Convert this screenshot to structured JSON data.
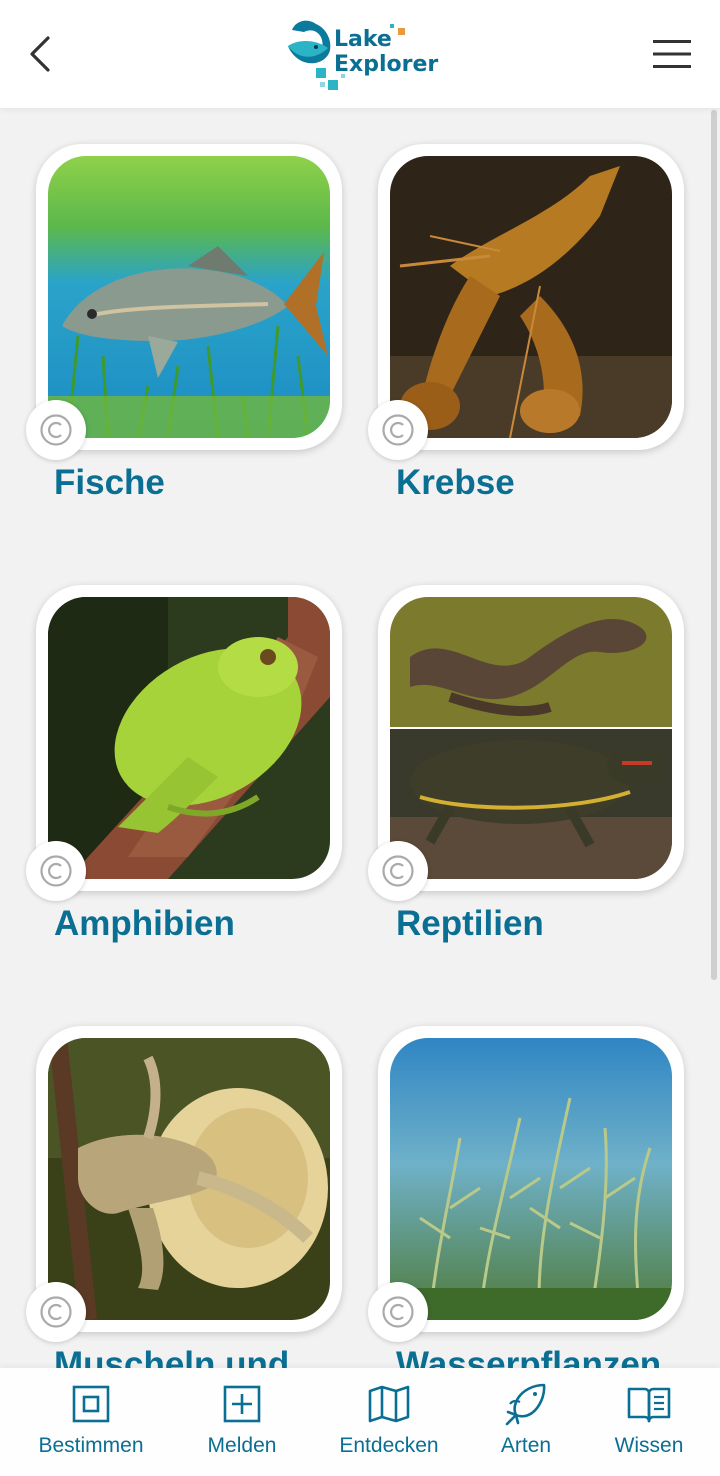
{
  "header": {
    "logo_line1": "Lake",
    "logo_line2": "Explorer",
    "back_icon": "chevron-left-icon",
    "menu_icon": "hamburger-menu-icon"
  },
  "categories": [
    {
      "label": "Fische",
      "image": "carp fish underwater"
    },
    {
      "label": "Krebse",
      "image": "crayfish"
    },
    {
      "label": "Amphibien",
      "image": "green tree frog on branch"
    },
    {
      "label": "Reptilien",
      "image": "grass snake and red-eared slider turtle"
    },
    {
      "label": "Muscheln und Schnecken",
      "image": "pond snail"
    },
    {
      "label": "Wasserpflanzen",
      "image": "underwater stonewort plants"
    }
  ],
  "copyright_icon": "copyright-icon",
  "bottom_nav": [
    {
      "label": "Bestimmen",
      "icon": "identify-square-icon"
    },
    {
      "label": "Melden",
      "icon": "report-plus-icon"
    },
    {
      "label": "Entdecken",
      "icon": "map-icon"
    },
    {
      "label": "Arten",
      "icon": "fish-species-icon"
    },
    {
      "label": "Wissen",
      "icon": "book-icon"
    }
  ],
  "colors": {
    "brand": "#0a6f93",
    "accent_orange": "#e89a3c",
    "accent_teal": "#2bb4c6",
    "background": "#f2f2f2"
  }
}
